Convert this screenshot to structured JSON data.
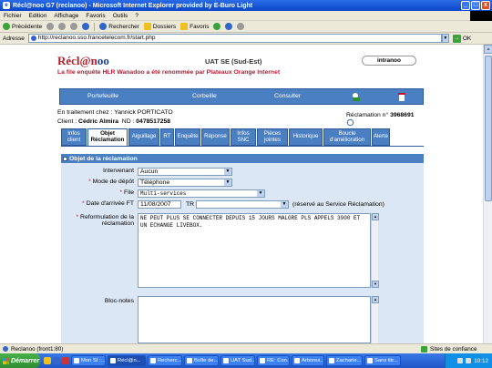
{
  "window": {
    "title": "Récl@noo G7 (reclanoo) - Microsoft Internet Explorer provided by E-Buro Light",
    "icon_glyph": "e",
    "buttons": {
      "minimize": "_",
      "maximize": "□",
      "close": "x"
    }
  },
  "menu": [
    "Fichier",
    "Edition",
    "Affichage",
    "Favoris",
    "Outils",
    "?"
  ],
  "toolbar": {
    "back": "Précédente",
    "search": "Rechercher",
    "folders": "Dossiers",
    "favorites": "Favoris"
  },
  "address": {
    "label": "Adresse",
    "url": "http://reclanoo.sso.francetelecom.fr/start.php",
    "go": "OK"
  },
  "header": {
    "logo_main": "Récl@n",
    "logo_tail": "oo",
    "site": "UAT SE (Sud-Est)",
    "intranoo": "intranoo",
    "notice": "La file enquête HLR Wanadoo a été renommée par Plateaux Orange Internet"
  },
  "nav": [
    "Portefeuille",
    "Corbeille",
    "Consulter"
  ],
  "case": {
    "traitement_label": "En traitement chez :",
    "traitement_value": "Yannick PORTICATO",
    "client_label": "Client :",
    "client_value": "Cédric Almira",
    "nd_label": "ND :",
    "nd_value": "0478517258",
    "reclamation_label": "Réclamation n°",
    "reclamation_value": "3968691"
  },
  "tabs": [
    {
      "label": "Infos client",
      "w": 28,
      "active": false
    },
    {
      "label": "Objet Réclamation",
      "w": 44,
      "active": true
    },
    {
      "label": "Aiguillage",
      "w": 34,
      "active": false
    },
    {
      "label": "RT",
      "w": 15,
      "active": false
    },
    {
      "label": "Enquête",
      "w": 28,
      "active": false
    },
    {
      "label": "Réponse",
      "w": 31,
      "active": false
    },
    {
      "label": "Infos SNC",
      "w": 28,
      "active": false
    },
    {
      "label": "Pièces jointes",
      "w": 34,
      "active": false
    },
    {
      "label": "Historique",
      "w": 37,
      "active": false
    },
    {
      "label": "Boucle d'amélioration",
      "w": 52,
      "active": false
    },
    {
      "label": "Alerte",
      "w": 20,
      "active": false
    }
  ],
  "section": {
    "title": "Objet de la réclamation"
  },
  "form": {
    "intervenant_label": "Intervenant",
    "intervenant_value": "Aucun",
    "mode_label": "Mode de dépôt",
    "mode_value": "Téléphone",
    "file_label": "File",
    "file_value": "Multi-services",
    "date_label": "Date d'arrivée FT",
    "date_value": "11/08/2007",
    "tr_label": "TR",
    "tr_value": "",
    "tr_note": "(réservé au Service Réclamation)",
    "reformulation_label": "Reformulation de la réclamation",
    "reformulation_value": "NE PEUT PLUS SE CONNECTER DEPUIS 15 JOURS MALGRE PLS APPELS 3900 ET UN ECHANGE LIVEBOX.",
    "blocnotes_label": "Bloc-notes",
    "blocnotes_value": "",
    "required_mark": "*"
  },
  "status": {
    "left": "Reclanoo (front1:80)",
    "zone": "Sites de confiance"
  },
  "taskbar": {
    "start": "Démarrer",
    "tasks": [
      {
        "label": "Mon SI :...",
        "active": false
      },
      {
        "label": "Récl@n...",
        "active": true
      },
      {
        "label": "Recherc...",
        "active": false
      },
      {
        "label": "Boîte de...",
        "active": false
      },
      {
        "label": "UAT Sud...",
        "active": false
      },
      {
        "label": "RE: Con...",
        "active": false
      },
      {
        "label": "Arbores...",
        "active": false
      },
      {
        "label": "Zacharie...",
        "active": false
      },
      {
        "label": "Sans titr...",
        "active": false
      }
    ],
    "clock": "10:12"
  }
}
